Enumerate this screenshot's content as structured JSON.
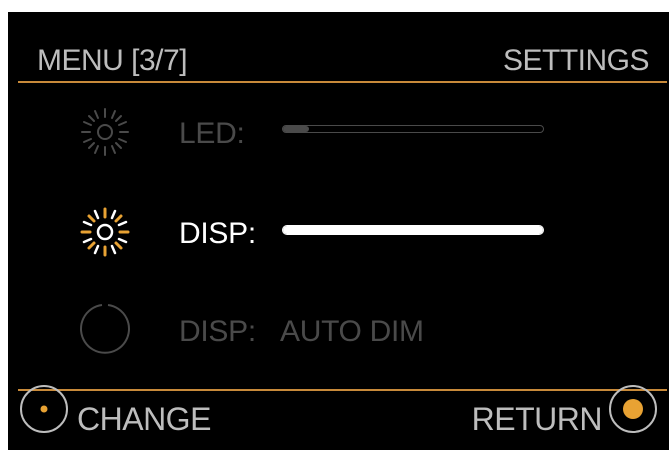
{
  "header": {
    "title": "MENU [3/7]",
    "section": "SETTINGS"
  },
  "rows": [
    {
      "icon": "brightness-icon",
      "label": "LED:",
      "level": 0.1,
      "state": "inactive"
    },
    {
      "icon": "brightness-icon",
      "label": "DISP:",
      "level": 1.0,
      "state": "selected"
    },
    {
      "icon": "circle-icon",
      "label": "DISP:",
      "value": "AUTO DIM",
      "state": "inactive"
    }
  ],
  "footer": {
    "left_label": "CHANGE",
    "right_label": "RETURN"
  },
  "colors": {
    "accent": "#c88a3a",
    "background": "#000000",
    "text_active": "#ffffff",
    "text_header": "#bdbdbd",
    "text_inactive": "#4a4a4a"
  }
}
